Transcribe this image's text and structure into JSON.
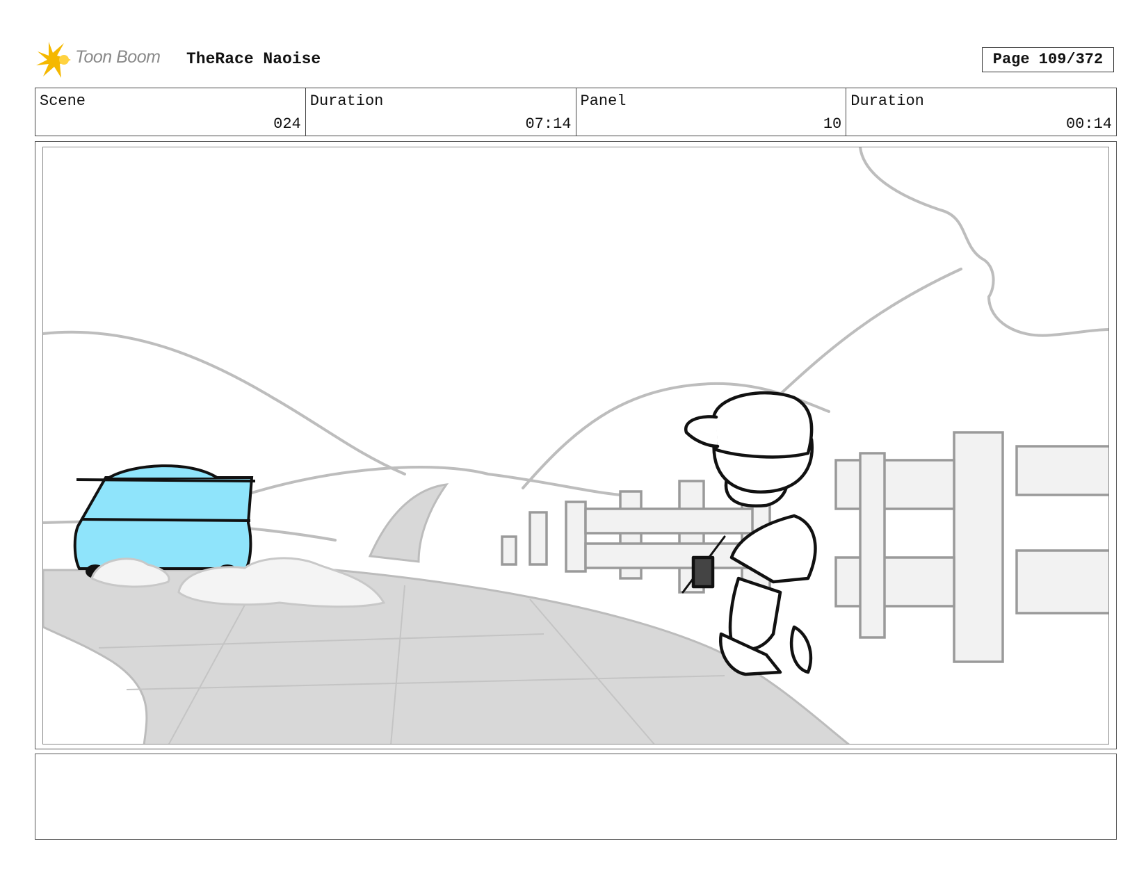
{
  "header": {
    "logo_text": "Toon Boom",
    "project_title": "TheRace Naoise",
    "page_label": "Page 109/372"
  },
  "info": {
    "scene_label": "Scene",
    "scene_value": "024",
    "scene_duration_label": "Duration",
    "scene_duration_value": "07:14",
    "panel_label": "Panel",
    "panel_value": "10",
    "panel_duration_label": "Duration",
    "panel_duration_value": "00:14"
  },
  "colors": {
    "logo_star": "#f5b800",
    "car_body": "#8fe4fb",
    "road": "#d8d8d8",
    "sketch_gray": "#b8b8b8"
  },
  "notes": {
    "text": ""
  }
}
